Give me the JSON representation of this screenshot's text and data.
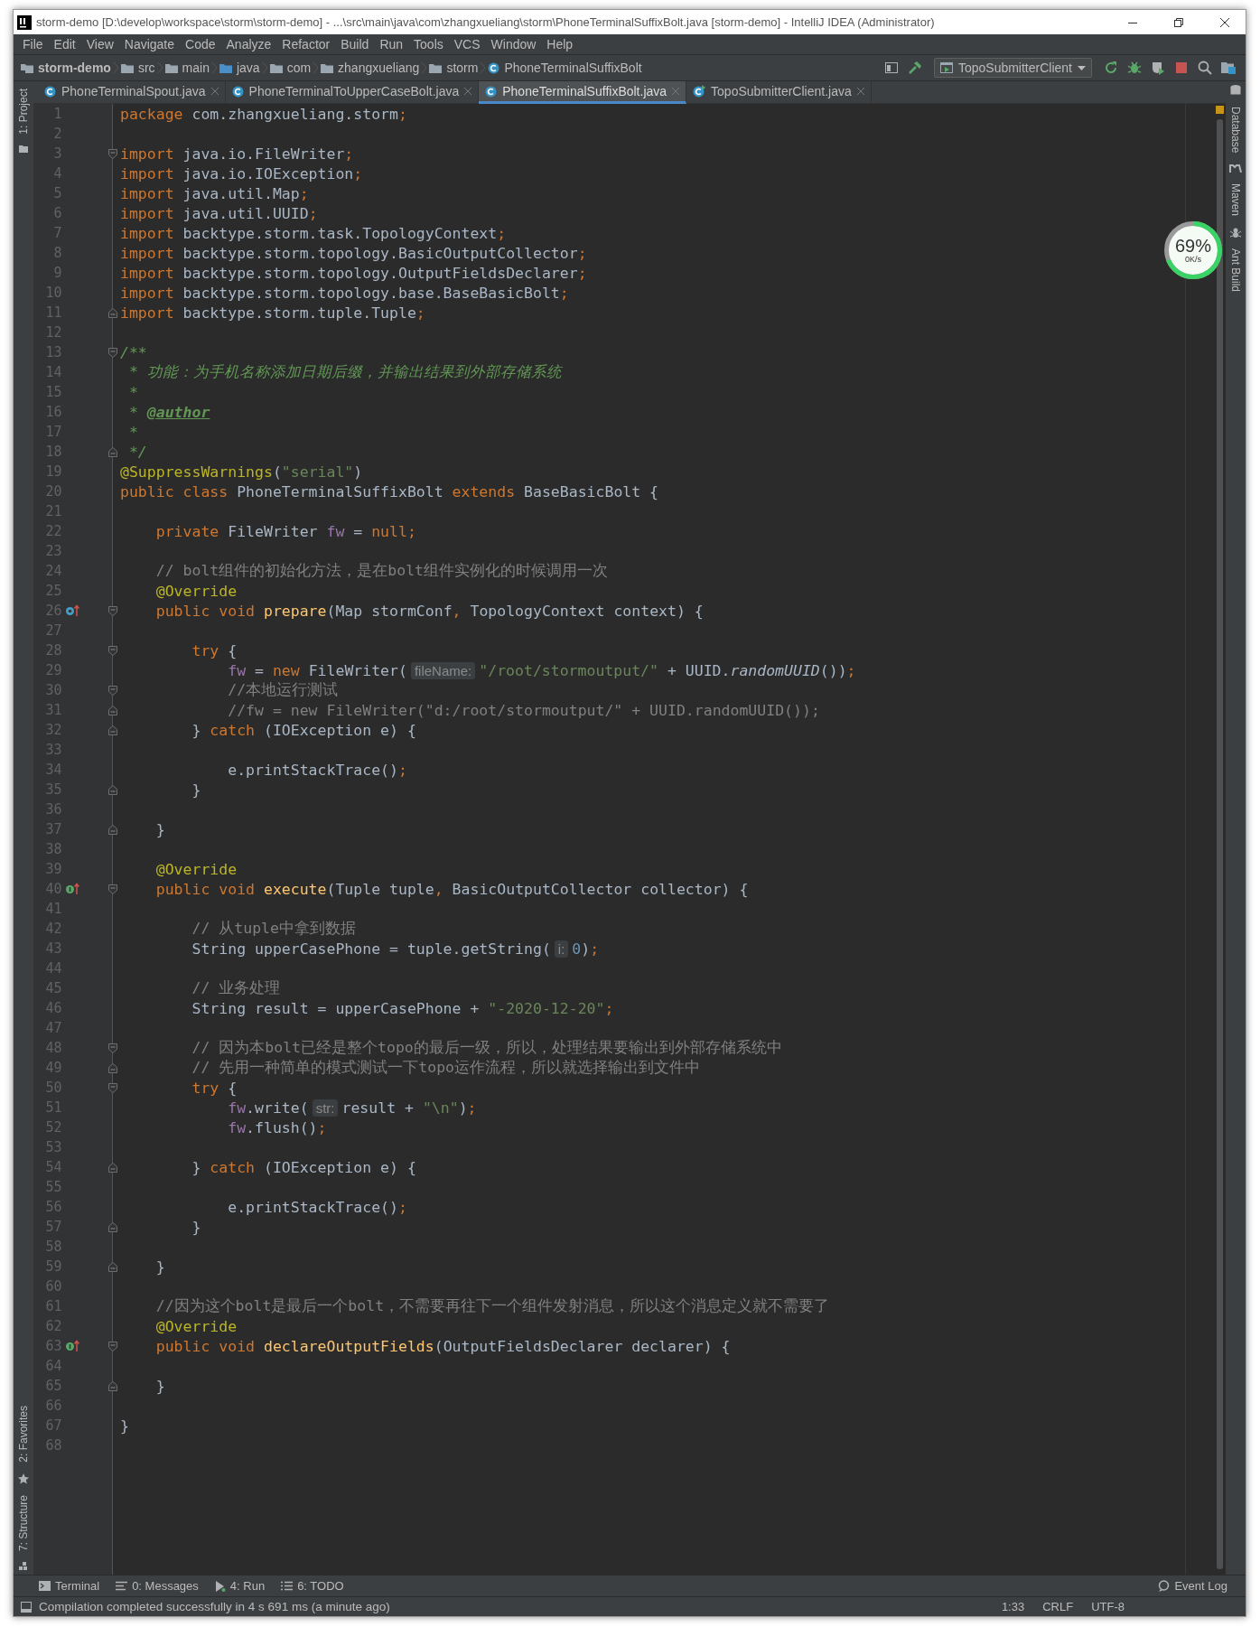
{
  "window": {
    "title": "storm-demo [D:\\develop\\workspace\\storm\\storm-demo] - ...\\src\\main\\java\\com\\zhangxueliang\\storm\\PhoneTerminalSuffixBolt.java [storm-demo] - IntelliJ IDEA (Administrator)"
  },
  "menu": [
    "File",
    "Edit",
    "View",
    "Navigate",
    "Code",
    "Analyze",
    "Refactor",
    "Build",
    "Run",
    "Tools",
    "VCS",
    "Window",
    "Help"
  ],
  "breadcrumbs": [
    {
      "label": "storm-demo",
      "kind": "project"
    },
    {
      "label": "src",
      "kind": "folder"
    },
    {
      "label": "main",
      "kind": "folder"
    },
    {
      "label": "java",
      "kind": "source"
    },
    {
      "label": "com",
      "kind": "folder"
    },
    {
      "label": "zhangxueliang",
      "kind": "folder"
    },
    {
      "label": "storm",
      "kind": "folder"
    },
    {
      "label": "PhoneTerminalSuffixBolt",
      "kind": "class"
    }
  ],
  "run_config": "TopoSubmitterClient",
  "tabs": [
    {
      "label": "PhoneTerminalSpout.java",
      "selected": false,
      "kind": "class"
    },
    {
      "label": "PhoneTerminalToUpperCaseBolt.java",
      "selected": false,
      "kind": "class"
    },
    {
      "label": "PhoneTerminalSuffixBolt.java",
      "selected": true,
      "kind": "class"
    },
    {
      "label": "TopoSubmitterClient.java",
      "selected": false,
      "kind": "main"
    }
  ],
  "left_tools": [
    {
      "label": "1: Project",
      "kind": "top"
    },
    {
      "label": "2: Favorites",
      "kind": "bottom"
    },
    {
      "label": "7: Structure",
      "kind": "bottom"
    }
  ],
  "right_tools": [
    "Database",
    "Maven",
    "Ant Build"
  ],
  "lines": [
    {
      "n": "1",
      "tokens": [
        {
          "text": "package",
          "kind": "kw"
        },
        {
          "text": " com.zhangxueliang.storm",
          "kind": "plain"
        },
        {
          "text": ";",
          "kind": "kw"
        }
      ]
    },
    {
      "n": "2"
    },
    {
      "n": "3",
      "gutter": [
        {
          "kind": "fold_start"
        }
      ],
      "tokens": [
        {
          "text": "import",
          "kind": "kw"
        },
        {
          "text": " java.io.FileWriter",
          "kind": "plain"
        },
        {
          "text": ";",
          "kind": "kw"
        }
      ]
    },
    {
      "n": "4",
      "tokens": [
        {
          "text": "import",
          "kind": "kw"
        },
        {
          "text": " java.io.IOException",
          "kind": "plain"
        },
        {
          "text": ";",
          "kind": "kw"
        }
      ]
    },
    {
      "n": "5",
      "tokens": [
        {
          "text": "import",
          "kind": "kw"
        },
        {
          "text": " java.util.Map",
          "kind": "plain"
        },
        {
          "text": ";",
          "kind": "kw"
        }
      ]
    },
    {
      "n": "6",
      "tokens": [
        {
          "text": "import",
          "kind": "kw"
        },
        {
          "text": " java.util.UUID",
          "kind": "plain"
        },
        {
          "text": ";",
          "kind": "kw"
        }
      ]
    },
    {
      "n": "7",
      "tokens": [
        {
          "text": "import",
          "kind": "kw"
        },
        {
          "text": " backtype.storm.task.TopologyContext",
          "kind": "plain"
        },
        {
          "text": ";",
          "kind": "kw"
        }
      ]
    },
    {
      "n": "8",
      "tokens": [
        {
          "text": "import",
          "kind": "kw"
        },
        {
          "text": " backtype.storm.topology.BasicOutputCollector",
          "kind": "plain"
        },
        {
          "text": ";",
          "kind": "kw"
        }
      ]
    },
    {
      "n": "9",
      "tokens": [
        {
          "text": "import",
          "kind": "kw"
        },
        {
          "text": " backtype.storm.topology.OutputFieldsDeclarer",
          "kind": "plain"
        },
        {
          "text": ";",
          "kind": "kw"
        }
      ]
    },
    {
      "n": "10",
      "tokens": [
        {
          "text": "import",
          "kind": "kw"
        },
        {
          "text": " backtype.storm.topology.base.BaseBasicBolt",
          "kind": "plain"
        },
        {
          "text": ";",
          "kind": "kw"
        }
      ]
    },
    {
      "n": "11",
      "gutter": [
        {
          "kind": "fold_end"
        }
      ],
      "tokens": [
        {
          "text": "import",
          "kind": "kw"
        },
        {
          "text": " backtype.storm.tuple.Tuple",
          "kind": "plain"
        },
        {
          "text": ";",
          "kind": "kw"
        }
      ]
    },
    {
      "n": "12"
    },
    {
      "n": "13",
      "gutter": [
        {
          "kind": "fold_start"
        }
      ],
      "tokens": [
        {
          "text": "/**",
          "kind": "doc"
        }
      ]
    },
    {
      "n": "14",
      "tokens": [
        {
          "text": " * 功能：为手机名称添加日期后缀，并输出结果到外部存储系统",
          "kind": "doc"
        }
      ]
    },
    {
      "n": "15",
      "tokens": [
        {
          "text": " *",
          "kind": "doc"
        }
      ]
    },
    {
      "n": "16",
      "tokens": [
        {
          "text": " * ",
          "kind": "doc"
        },
        {
          "text": "@author",
          "kind": "doctag"
        }
      ]
    },
    {
      "n": "17",
      "tokens": [
        {
          "text": " *",
          "kind": "doc"
        }
      ]
    },
    {
      "n": "18",
      "gutter": [
        {
          "kind": "fold_end"
        }
      ],
      "tokens": [
        {
          "text": " */",
          "kind": "doc"
        }
      ]
    },
    {
      "n": "19",
      "tokens": [
        {
          "text": "@SuppressWarnings",
          "kind": "ann"
        },
        {
          "text": "(",
          "kind": "plain"
        },
        {
          "text": "\"serial\"",
          "kind": "str"
        },
        {
          "text": ")",
          "kind": "plain"
        }
      ]
    },
    {
      "n": "20",
      "tokens": [
        {
          "text": "public class ",
          "kind": "kw"
        },
        {
          "text": "PhoneTerminalSuffixBolt ",
          "kind": "plain"
        },
        {
          "text": "extends ",
          "kind": "kw"
        },
        {
          "text": "BaseBasicBolt {",
          "kind": "plain"
        }
      ]
    },
    {
      "n": "21"
    },
    {
      "n": "22",
      "tokens": [
        {
          "text": "    private ",
          "kind": "kw"
        },
        {
          "text": "FileWriter ",
          "kind": "plain"
        },
        {
          "text": "fw",
          "kind": "field"
        },
        {
          "text": " = ",
          "kind": "plain"
        },
        {
          "text": "null;",
          "kind": "kw"
        }
      ]
    },
    {
      "n": "23"
    },
    {
      "n": "24",
      "tokens": [
        {
          "text": "    // bolt组件的初始化方法，是在bolt组件实例化的时候调用一次",
          "kind": "comment"
        }
      ]
    },
    {
      "n": "25",
      "tokens": [
        {
          "text": "    @Override",
          "kind": "ann"
        }
      ]
    },
    {
      "n": "26",
      "gutter": [
        {
          "kind": "override"
        },
        {
          "kind": "fold_start"
        }
      ],
      "tokens": [
        {
          "text": "    public void ",
          "kind": "kw"
        },
        {
          "text": "prepare",
          "kind": "fn"
        },
        {
          "text": "(Map stormConf",
          "kind": "plain"
        },
        {
          "text": ", ",
          "kind": "kw"
        },
        {
          "text": "TopologyContext context) {",
          "kind": "plain"
        }
      ]
    },
    {
      "n": "27"
    },
    {
      "n": "28",
      "gutter": [
        {
          "kind": "fold_start"
        }
      ],
      "tokens": [
        {
          "text": "        try ",
          "kind": "kw"
        },
        {
          "text": "{",
          "kind": "plain"
        }
      ]
    },
    {
      "n": "29",
      "tokens": [
        {
          "text": "            fw",
          "kind": "field"
        },
        {
          "text": " = ",
          "kind": "plain"
        },
        {
          "text": "new ",
          "kind": "kw"
        },
        {
          "text": "FileWriter(",
          "kind": "plain"
        },
        {
          "text": "fileName:",
          "kind": "hint"
        },
        {
          "text": "\"/root/stormoutput/\"",
          "kind": "str"
        },
        {
          "text": " + UUID.",
          "kind": "plain"
        },
        {
          "text": "randomUUID",
          "kind": "italic"
        },
        {
          "text": "())",
          "kind": "plain"
        },
        {
          "text": ";",
          "kind": "kw"
        }
      ]
    },
    {
      "n": "30",
      "gutter": [
        {
          "kind": "fold_start"
        }
      ],
      "tokens": [
        {
          "text": "            //本地运行测试",
          "kind": "comment"
        }
      ]
    },
    {
      "n": "31",
      "gutter": [
        {
          "kind": "fold_end"
        }
      ],
      "tokens": [
        {
          "text": "            //fw = new FileWriter(\"d:/root/stormoutput/\" + UUID.randomUUID());",
          "kind": "comment"
        }
      ]
    },
    {
      "n": "32",
      "gutter": [
        {
          "kind": "fold_end"
        }
      ],
      "tokens": [
        {
          "text": "        } ",
          "kind": "plain"
        },
        {
          "text": "catch ",
          "kind": "kw"
        },
        {
          "text": "(IOException e) {",
          "kind": "plain"
        }
      ]
    },
    {
      "n": "33"
    },
    {
      "n": "34",
      "tokens": [
        {
          "text": "            e.printStackTrace()",
          "kind": "plain"
        },
        {
          "text": ";",
          "kind": "kw"
        }
      ]
    },
    {
      "n": "35",
      "gutter": [
        {
          "kind": "fold_end"
        }
      ],
      "tokens": [
        {
          "text": "        }",
          "kind": "plain"
        }
      ]
    },
    {
      "n": "36"
    },
    {
      "n": "37",
      "gutter": [
        {
          "kind": "fold_end"
        }
      ],
      "tokens": [
        {
          "text": "    }",
          "kind": "plain"
        }
      ]
    },
    {
      "n": "38"
    },
    {
      "n": "39",
      "tokens": [
        {
          "text": "    @Override",
          "kind": "ann"
        }
      ]
    },
    {
      "n": "40",
      "gutter": [
        {
          "kind": "implement"
        },
        {
          "kind": "fold_start"
        }
      ],
      "tokens": [
        {
          "text": "    public void ",
          "kind": "kw"
        },
        {
          "text": "execute",
          "kind": "fn"
        },
        {
          "text": "(Tuple tuple",
          "kind": "plain"
        },
        {
          "text": ", ",
          "kind": "kw"
        },
        {
          "text": "BasicOutputCollector collector) {",
          "kind": "plain"
        }
      ]
    },
    {
      "n": "41"
    },
    {
      "n": "42",
      "tokens": [
        {
          "text": "        // 从tuple中拿到数据",
          "kind": "comment"
        }
      ]
    },
    {
      "n": "43",
      "tokens": [
        {
          "text": "        String upperCasePhone = tuple.getString(",
          "kind": "plain"
        },
        {
          "text": "i:",
          "kind": "hint"
        },
        {
          "text": "0",
          "kind": "num"
        },
        {
          "text": ")",
          "kind": "plain"
        },
        {
          "text": ";",
          "kind": "kw"
        }
      ]
    },
    {
      "n": "44"
    },
    {
      "n": "45",
      "tokens": [
        {
          "text": "        // 业务处理",
          "kind": "comment"
        }
      ]
    },
    {
      "n": "46",
      "tokens": [
        {
          "text": "        String result = upperCasePhone + ",
          "kind": "plain"
        },
        {
          "text": "\"-2020-12-20\"",
          "kind": "str"
        },
        {
          "text": ";",
          "kind": "kw"
        }
      ]
    },
    {
      "n": "47"
    },
    {
      "n": "48",
      "gutter": [
        {
          "kind": "fold_start"
        }
      ],
      "tokens": [
        {
          "text": "        // 因为本bolt已经是整个topo的最后一级，所以，处理结果要输出到外部存储系统中",
          "kind": "comment"
        }
      ]
    },
    {
      "n": "49",
      "gutter": [
        {
          "kind": "fold_end"
        }
      ],
      "tokens": [
        {
          "text": "        // 先用一种简单的模式测试一下topo运作流程，所以就选择输出到文件中",
          "kind": "comment"
        }
      ]
    },
    {
      "n": "50",
      "gutter": [
        {
          "kind": "fold_start"
        }
      ],
      "tokens": [
        {
          "text": "        try ",
          "kind": "kw"
        },
        {
          "text": "{",
          "kind": "plain"
        }
      ]
    },
    {
      "n": "51",
      "tokens": [
        {
          "text": "            fw",
          "kind": "field"
        },
        {
          "text": ".write(",
          "kind": "plain"
        },
        {
          "text": "str:",
          "kind": "hint"
        },
        {
          "text": "result + ",
          "kind": "plain"
        },
        {
          "text": "\"\\n\"",
          "kind": "str"
        },
        {
          "text": ")",
          "kind": "plain"
        },
        {
          "text": ";",
          "kind": "kw"
        }
      ]
    },
    {
      "n": "52",
      "tokens": [
        {
          "text": "            fw",
          "kind": "field"
        },
        {
          "text": ".flush()",
          "kind": "plain"
        },
        {
          "text": ";",
          "kind": "kw"
        }
      ]
    },
    {
      "n": "53"
    },
    {
      "n": "54",
      "gutter": [
        {
          "kind": "fold_end"
        }
      ],
      "tokens": [
        {
          "text": "        } ",
          "kind": "plain"
        },
        {
          "text": "catch ",
          "kind": "kw"
        },
        {
          "text": "(IOException e) {",
          "kind": "plain"
        }
      ]
    },
    {
      "n": "55"
    },
    {
      "n": "56",
      "tokens": [
        {
          "text": "            e.printStackTrace()",
          "kind": "plain"
        },
        {
          "text": ";",
          "kind": "kw"
        }
      ]
    },
    {
      "n": "57",
      "gutter": [
        {
          "kind": "fold_end"
        }
      ],
      "tokens": [
        {
          "text": "        }",
          "kind": "plain"
        }
      ]
    },
    {
      "n": "58"
    },
    {
      "n": "59",
      "gutter": [
        {
          "kind": "fold_end"
        }
      ],
      "tokens": [
        {
          "text": "    }",
          "kind": "plain"
        }
      ]
    },
    {
      "n": "60"
    },
    {
      "n": "61",
      "tokens": [
        {
          "text": "    //因为这个bolt是最后一个bolt，不需要再往下一个组件发射消息，所以这个消息定义就不需要了",
          "kind": "comment"
        }
      ]
    },
    {
      "n": "62",
      "tokens": [
        {
          "text": "    @Override",
          "kind": "ann"
        }
      ]
    },
    {
      "n": "63",
      "gutter": [
        {
          "kind": "implement"
        },
        {
          "kind": "fold_start"
        }
      ],
      "tokens": [
        {
          "text": "    public void ",
          "kind": "kw"
        },
        {
          "text": "declareOutputFields",
          "kind": "fn"
        },
        {
          "text": "(OutputFieldsDeclarer declarer) {",
          "kind": "plain"
        }
      ]
    },
    {
      "n": "64"
    },
    {
      "n": "65",
      "gutter": [
        {
          "kind": "fold_end"
        }
      ],
      "tokens": [
        {
          "text": "    }",
          "kind": "plain"
        }
      ]
    },
    {
      "n": "66"
    },
    {
      "n": "67",
      "tokens": [
        {
          "text": "}",
          "kind": "plain"
        }
      ]
    },
    {
      "n": "68"
    }
  ],
  "monitor": {
    "percent": "69%",
    "speed": "0K/s",
    "level": 0.69
  },
  "bottom_tools": [
    {
      "label": "Terminal",
      "kind": "terminal"
    },
    {
      "label": "0: Messages",
      "kind": "messages"
    },
    {
      "label": "4: Run",
      "kind": "run"
    },
    {
      "label": "6: TODO",
      "kind": "todo"
    }
  ],
  "event_log": "Event Log",
  "status_bar": {
    "message": "Compilation completed successfully in 4 s 691 ms (a minute ago)",
    "items": [
      "1:33",
      "CRLF",
      "UTF-8"
    ]
  }
}
